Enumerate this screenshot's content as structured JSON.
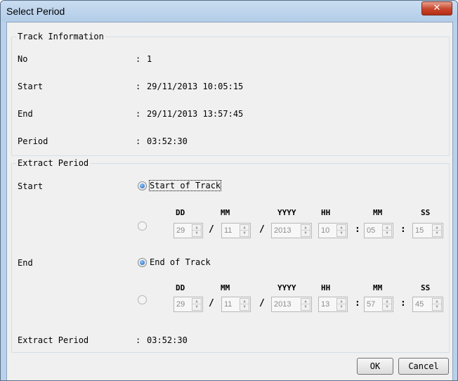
{
  "window": {
    "title": "Select Period",
    "close_glyph": "✕"
  },
  "track_info": {
    "legend": "Track Information",
    "rows": [
      {
        "label": "No",
        "value": "1"
      },
      {
        "label": "Start",
        "value": "29/11/2013 10:05:15"
      },
      {
        "label": "End",
        "value": "29/11/2013 13:57:45"
      },
      {
        "label": "Period",
        "value": "03:52:30"
      }
    ],
    "separator": ":"
  },
  "extract": {
    "legend": "Extract Period",
    "start_label": "Start",
    "end_label": "End",
    "start_option": "Start of Track",
    "end_option": "End of Track",
    "columns": {
      "dd": "DD",
      "mm": "MM",
      "yyyy": "YYYY",
      "hh": "HH",
      "min": "MM",
      "ss": "SS"
    },
    "date_sep": "/",
    "time_sep": ":",
    "start_values": {
      "dd": "29",
      "mm": "11",
      "yyyy": "2013",
      "hh": "10",
      "min": "05",
      "ss": "15"
    },
    "end_values": {
      "dd": "29",
      "mm": "11",
      "yyyy": "2013",
      "hh": "13",
      "min": "57",
      "ss": "45"
    },
    "period_label": "Extract Period",
    "period_value": "03:52:30"
  },
  "buttons": {
    "ok": "OK",
    "cancel": "Cancel"
  }
}
